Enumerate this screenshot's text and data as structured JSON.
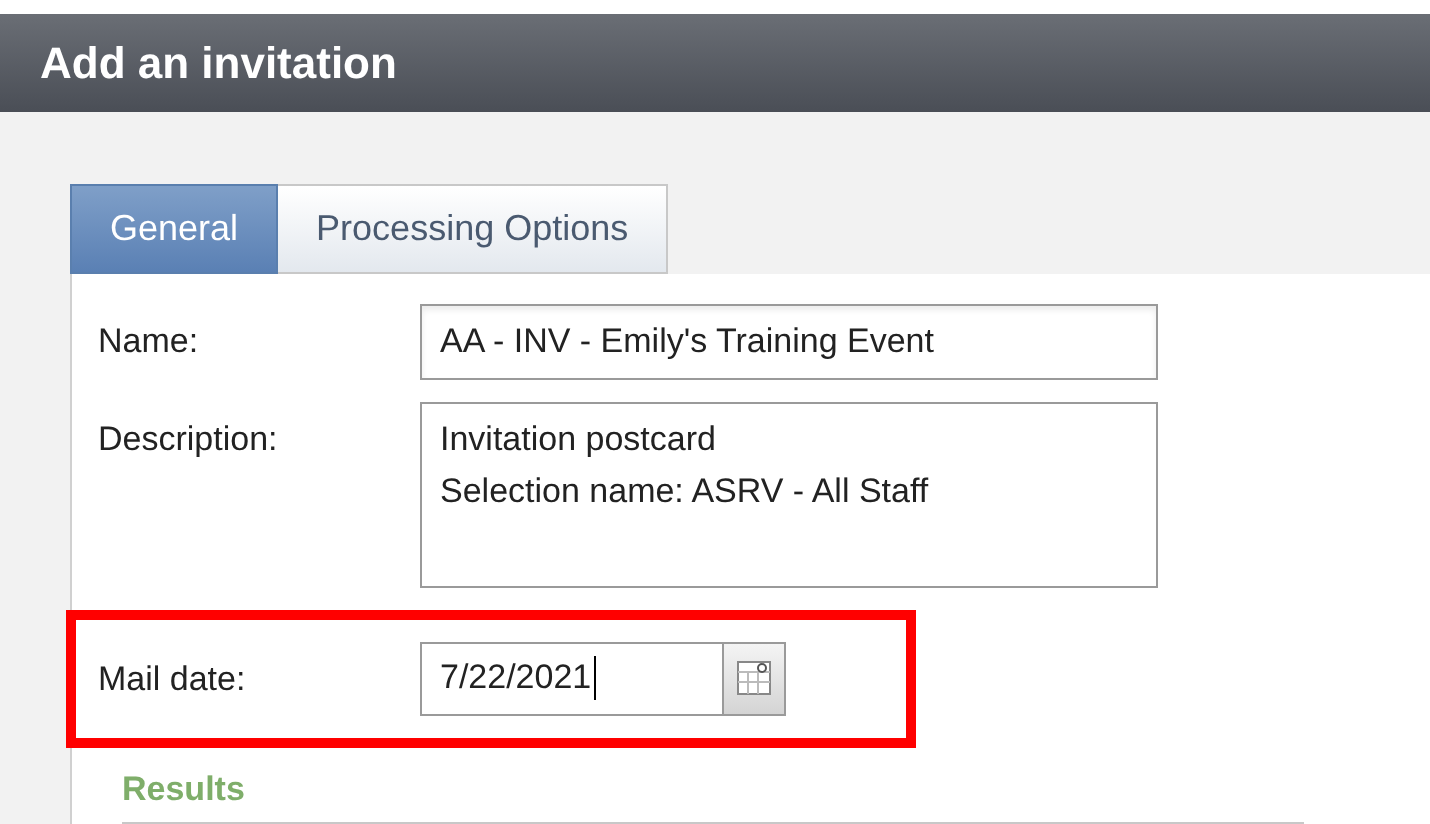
{
  "window": {
    "title": "Add an invitation"
  },
  "tabs": [
    {
      "label": "General",
      "selected": true
    },
    {
      "label": "Processing Options",
      "selected": false
    }
  ],
  "fields": [
    {
      "kind": "text",
      "label": "Name:",
      "value": "AA - INV - Emily's Training Event"
    },
    {
      "kind": "multiline",
      "label": "Description:",
      "lines": [
        "Invitation postcard",
        "Selection name: ASRV - All Staff"
      ]
    },
    {
      "kind": "date",
      "label": "Mail date:",
      "value": "7/22/2021",
      "highlighted": true
    }
  ],
  "section": {
    "title": "Results"
  }
}
